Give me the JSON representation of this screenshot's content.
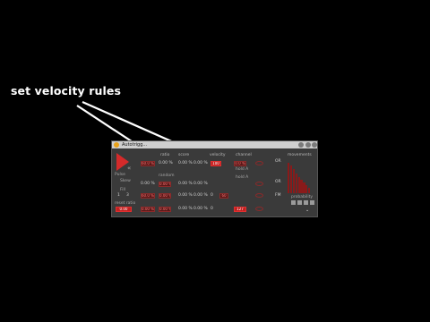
{
  "callout": {
    "text": "set velocity rules"
  },
  "device": {
    "title": "Autotrigg...",
    "headers": {
      "ratio": "ratio",
      "score": "score",
      "velocity": "velocity",
      "channel": "channel",
      "movements": "movements"
    },
    "left_labels": {
      "pulse": "Pulse",
      "skew": "Skew",
      "fill": "Fill",
      "reset": "reset",
      "ratio": "reset ratio",
      "random": "random",
      "probability": "probability"
    },
    "rows": [
      {
        "a": "60.0 %",
        "b": "0.00 %",
        "c": "0.00 %",
        "vel": "100",
        "ch": "0.0 %",
        "mode": "OR"
      },
      {
        "a": "0.00 %",
        "b": "0.00 %",
        "c": "0.00 %",
        "vel": "",
        "ch": "",
        "mode": "OR"
      },
      {
        "a": "60.0 %",
        "b": "0.00 %",
        "c": "0.00 %",
        "vel": "0",
        "ch": "60",
        "mode": "FM"
      },
      {
        "a": "0.00 %",
        "b": "0.00 %",
        "c": "0.00 %",
        "vel": "0",
        "ch": "127",
        "mode": ""
      }
    ],
    "hold_a": "hold A",
    "hold_b": "hold A",
    "left_values": {
      "top": "60.0",
      "mid": "0.00",
      "low1": "1",
      "low2": "3",
      "ratio_val": "0.00"
    }
  },
  "movement_bars": [
    0.95,
    0.85,
    0.75,
    0.62,
    0.5,
    0.42,
    0.33,
    0.26,
    0.18
  ],
  "colors": {
    "accent": "#d42a2a",
    "panel": "#3a3a3a",
    "bg": "#000000"
  }
}
